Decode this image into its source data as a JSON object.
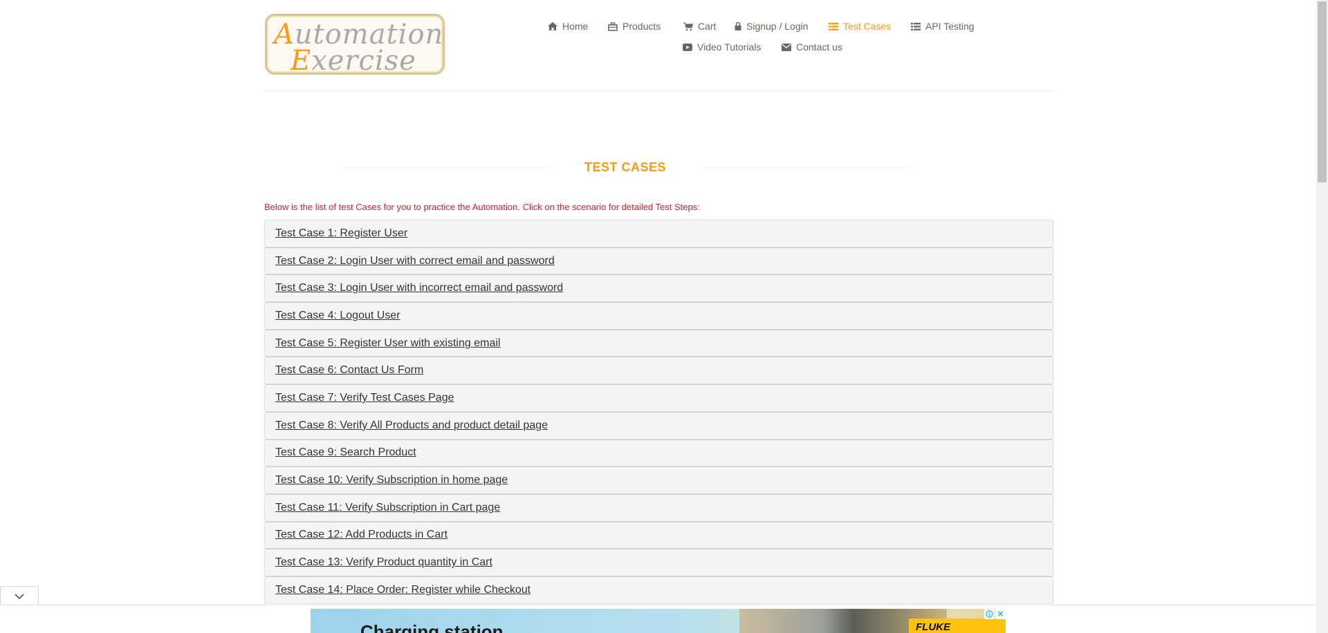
{
  "logo": {
    "line1_cap": "A",
    "line1_rest": "utomation",
    "line2_cap": "E",
    "line2_rest": "xercise"
  },
  "nav": {
    "items": [
      {
        "label": "Home",
        "icon": "home-icon"
      },
      {
        "label": "Products",
        "icon": "products-icon"
      },
      {
        "label": "Cart",
        "icon": "cart-icon"
      },
      {
        "label": "Signup / Login",
        "icon": "lock-icon"
      },
      {
        "label": "Test Cases",
        "icon": "list-icon",
        "active": true
      },
      {
        "label": "API Testing",
        "icon": "list-icon"
      },
      {
        "label": "Video Tutorials",
        "icon": "youtube-play-icon"
      },
      {
        "label": "Contact us",
        "icon": "envelope-icon"
      }
    ]
  },
  "section": {
    "title": "TEST CASES",
    "intro": "Below is the list of test Cases for you to practice the Automation. Click on the scenario for detailed Test Steps:"
  },
  "test_cases": [
    "Test Case 1: Register User",
    "Test Case 2: Login User with correct email and password",
    "Test Case 3: Login User with incorrect email and password",
    "Test Case 4: Logout User",
    "Test Case 5: Register User with existing email",
    "Test Case 6: Contact Us Form",
    "Test Case 7: Verify Test Cases Page",
    "Test Case 8: Verify All Products and product detail page",
    "Test Case 9: Search Product",
    "Test Case 10: Verify Subscription in home page",
    "Test Case 11: Verify Subscription in Cart page",
    "Test Case 12: Add Products in Cart",
    "Test Case 13: Verify Product quantity in Cart",
    "Test Case 14: Place Order: Register while Checkout"
  ],
  "ad": {
    "headline": "Charging station",
    "brand": "FLUKE",
    "close_label": "✕"
  },
  "colors": {
    "accent": "#fe980f",
    "intro_text": "#e51c23",
    "nav_text": "#696763",
    "row_bg": "#f5f5f5"
  }
}
